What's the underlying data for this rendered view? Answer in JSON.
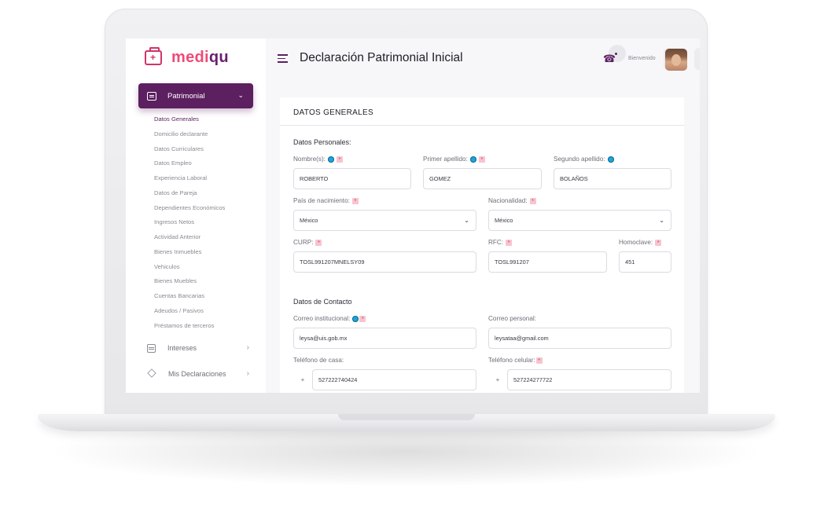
{
  "app": {
    "brand_part1": "medi",
    "brand_part2": "qu"
  },
  "sidebar": {
    "active_section": "Patrimonial",
    "sub_items": [
      "Datos Generales",
      "Domicilio declarante",
      "Datos Curriculares",
      "Datos Empleo",
      "Experiencia Laboral",
      "Datos de Pareja",
      "Dependientes Económicos",
      "Ingresos Netos",
      "Actividad Anterior",
      "Bienes Inmuebles",
      "Vehiculos",
      "Bienes Muebles",
      "Cuentas Bancarias",
      "Adeudos / Pasivos",
      "Préstamos de terceros"
    ],
    "items": [
      {
        "label": "Intereses"
      },
      {
        "label": "Mis Declaraciones"
      }
    ]
  },
  "topbar": {
    "title": "Declaración Patrimonial Inicial",
    "welcome": "Bienvenido",
    "icons": [
      "collapse-icon",
      "apps-grid-icon",
      "notification-icon",
      "menu-icon"
    ]
  },
  "form": {
    "card_title": "DATOS GENERALES",
    "personal_title": "Datos Personales:",
    "contact_title": "Datos de Contacto",
    "req_mark": "*",
    "fields": {
      "nombre": {
        "label": "Nombre(s):",
        "value": "ROBERTO"
      },
      "primer_apellido": {
        "label": "Primer apellido:",
        "value": "GOMEZ"
      },
      "segundo_apellido": {
        "label": "Segundo apellido:",
        "value": "BOLAÑOS"
      },
      "pais": {
        "label": "País de nacimiento:",
        "value": "México"
      },
      "nacionalidad": {
        "label": "Nacionalidad:",
        "value": "México"
      },
      "curp": {
        "label": "CURP:",
        "value": "TOSL991207MNELSY09"
      },
      "rfc": {
        "label": "RFC:",
        "value": "TOSL991207"
      },
      "homoclave": {
        "label": "Homoclave:",
        "value": "451"
      },
      "correo_inst": {
        "label": "Correo institucional:",
        "value": "leysa@uis.gob.mx"
      },
      "correo_personal": {
        "label": "Correo personal:",
        "value": "leysataa@gmail.com"
      },
      "tel_casa": {
        "label": "Teléfono de casa:",
        "prefix": "+",
        "value": "527222740424"
      },
      "tel_celular": {
        "label": "Teléfono celular:",
        "prefix": "+",
        "value": "527224277722"
      }
    }
  },
  "colors": {
    "primary": "#5c1f60",
    "brand_pink": "#ef4b78",
    "info": "#20a4d8",
    "required_bg": "#f7c4cf"
  }
}
